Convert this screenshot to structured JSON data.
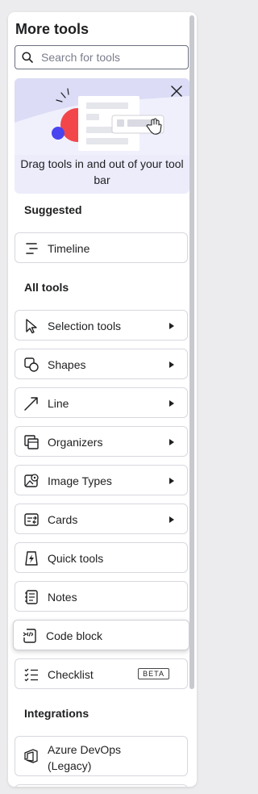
{
  "panel": {
    "title": "More tools"
  },
  "search": {
    "placeholder": "Search for tools"
  },
  "promo": {
    "text": "Drag tools in and out of your tool bar"
  },
  "sections": {
    "suggested": "Suggested",
    "all_tools": "All tools",
    "integrations": "Integrations"
  },
  "suggested": [
    {
      "label": "Timeline",
      "icon": "timeline-icon"
    }
  ],
  "tools": [
    {
      "label": "Selection tools",
      "icon": "cursor-icon",
      "submenu": true
    },
    {
      "label": "Shapes",
      "icon": "shapes-icon",
      "submenu": true
    },
    {
      "label": "Line",
      "icon": "line-icon",
      "submenu": true
    },
    {
      "label": "Organizers",
      "icon": "organizer-icon",
      "submenu": true
    },
    {
      "label": "Image Types",
      "icon": "image-icon",
      "submenu": true
    },
    {
      "label": "Cards",
      "icon": "cards-icon",
      "submenu": true
    },
    {
      "label": "Quick tools",
      "icon": "quick-tools-icon",
      "submenu": false
    },
    {
      "label": "Notes",
      "icon": "notes-icon",
      "submenu": false
    },
    {
      "label": "Code block",
      "icon": "code-block-icon",
      "submenu": false
    },
    {
      "label": "Checklist",
      "icon": "checklist-icon",
      "submenu": false,
      "badge": "BETA"
    }
  ],
  "integrations": [
    {
      "label": "Azure DevOps (Legacy)",
      "icon": "azure-devops-icon"
    }
  ]
}
